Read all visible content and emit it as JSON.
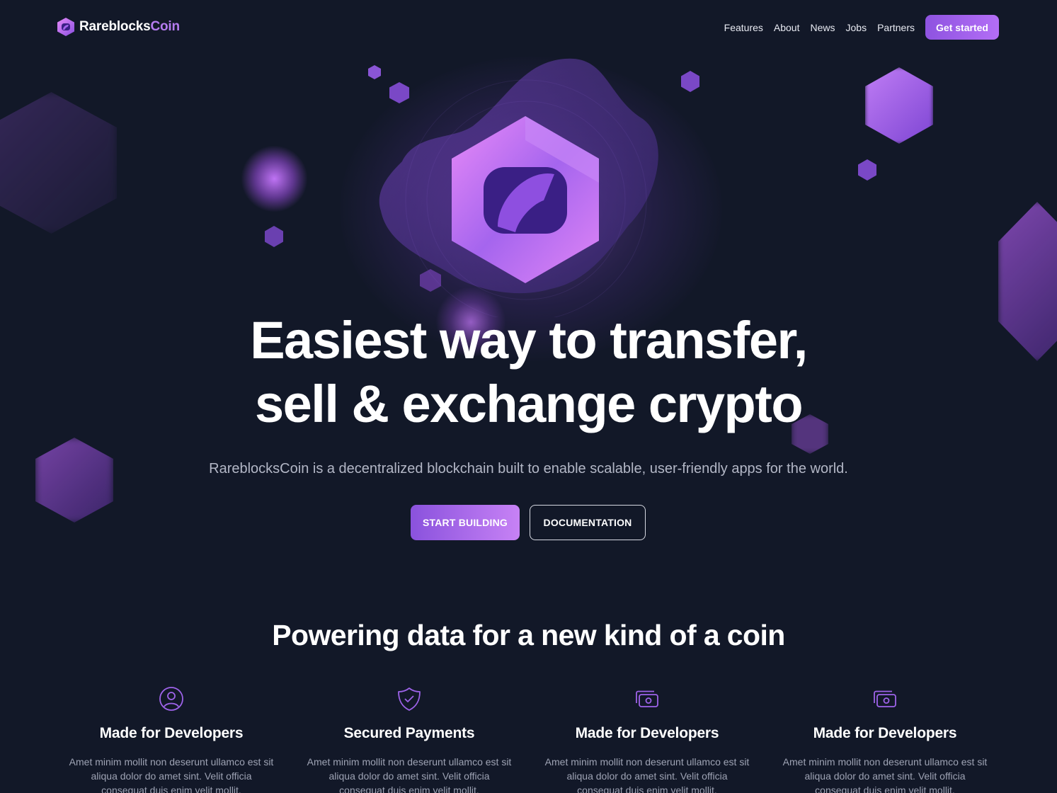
{
  "nav": {
    "brand_primary": "Rareblocks",
    "brand_accent": "Coin",
    "links": [
      {
        "label": "Features"
      },
      {
        "label": "About"
      },
      {
        "label": "News"
      },
      {
        "label": "Jobs"
      },
      {
        "label": "Partners"
      }
    ],
    "cta_label": "Get started"
  },
  "hero": {
    "title_line1": "Easiest way to transfer,",
    "title_line2": "sell & exchange crypto",
    "subtitle": "RareblocksCoin is a decentralized blockchain built to enable scalable, user-friendly apps for the world.",
    "primary_button": "START BUILDING",
    "secondary_button": "DOCUMENTATION"
  },
  "features_section": {
    "title": "Powering data for a new kind of a coin",
    "items": [
      {
        "icon": "user-circle-icon",
        "title": "Made for Developers",
        "description": "Amet minim mollit non deserunt ullamco est sit aliqua dolor do amet sint. Velit officia consequat duis enim velit mollit."
      },
      {
        "icon": "shield-check-icon",
        "title": "Secured Payments",
        "description": "Amet minim mollit non deserunt ullamco est sit aliqua dolor do amet sint. Velit officia consequat duis enim velit mollit."
      },
      {
        "icon": "cash-icon",
        "title": "Made for Developers",
        "description": "Amet minim mollit non deserunt ullamco est sit aliqua dolor do amet sint. Velit officia consequat duis enim velit mollit."
      },
      {
        "icon": "cash-icon",
        "title": "Made for Developers",
        "description": "Amet minim mollit non deserunt ullamco est sit aliqua dolor do amet sint. Velit officia consequat duis enim velit mollit."
      }
    ]
  },
  "theme": {
    "background": "#121828",
    "accent": "#a463ed",
    "accent_light": "#c782f5",
    "text_muted": "#b3b7c6"
  }
}
